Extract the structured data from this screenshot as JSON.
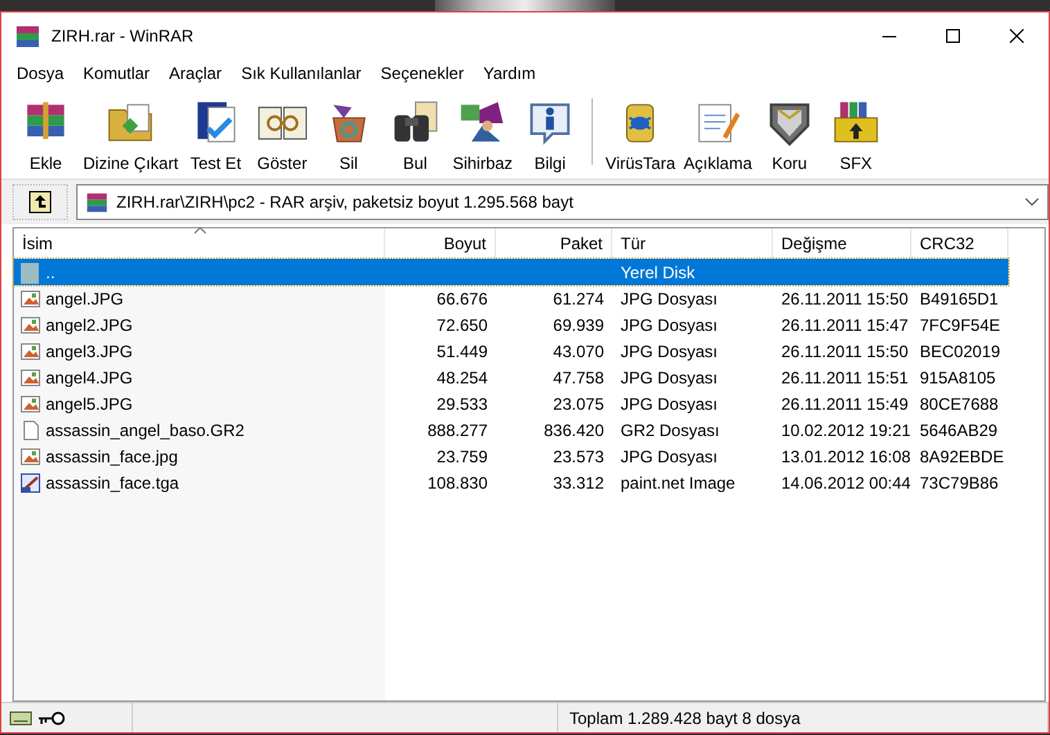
{
  "window": {
    "title": "ZIRH.rar - WinRAR"
  },
  "menu": [
    "Dosya",
    "Komutlar",
    "Araçlar",
    "Sık Kullanılanlar",
    "Seçenekler",
    "Yardım"
  ],
  "toolbar": [
    {
      "label": "Ekle",
      "kind": "books"
    },
    {
      "label": "Dizine Çıkart",
      "kind": "folder"
    },
    {
      "label": "Test Et",
      "kind": "check"
    },
    {
      "label": "Göster",
      "kind": "glasses"
    },
    {
      "label": "Sil",
      "kind": "recycle"
    },
    {
      "label": "Bul",
      "kind": "binoculars"
    },
    {
      "label": "Sihirbaz",
      "kind": "wizard"
    },
    {
      "label": "Bilgi",
      "kind": "info"
    },
    {
      "label": "VirüsTara",
      "kind": "bug"
    },
    {
      "label": "Açıklama",
      "kind": "notepad"
    },
    {
      "label": "Koru",
      "kind": "shield"
    },
    {
      "label": "SFX",
      "kind": "box"
    }
  ],
  "address": {
    "path": "ZIRH.rar\\ZIRH\\pc2 - RAR arşiv, paketsiz boyut 1.295.568 bayt"
  },
  "table": {
    "columns": [
      "İsim",
      "Boyut",
      "Paket",
      "Tür",
      "Değişme",
      "CRC32"
    ],
    "rows": [
      {
        "kind": "up",
        "selected": true,
        "cells": [
          "..",
          "",
          "",
          "Yerel Disk",
          "",
          ""
        ]
      },
      {
        "kind": "image",
        "selected": false,
        "cells": [
          "angel.JPG",
          "66.676",
          "61.274",
          "JPG Dosyası",
          "26.11.2011 15:50",
          "B49165D1"
        ]
      },
      {
        "kind": "image",
        "selected": false,
        "cells": [
          "angel2.JPG",
          "72.650",
          "69.939",
          "JPG Dosyası",
          "26.11.2011 15:47",
          "7FC9F54E"
        ]
      },
      {
        "kind": "image",
        "selected": false,
        "cells": [
          "angel3.JPG",
          "51.449",
          "43.070",
          "JPG Dosyası",
          "26.11.2011 15:50",
          "BEC02019"
        ]
      },
      {
        "kind": "image",
        "selected": false,
        "cells": [
          "angel4.JPG",
          "48.254",
          "47.758",
          "JPG Dosyası",
          "26.11.2011 15:51",
          "915A8105"
        ]
      },
      {
        "kind": "image",
        "selected": false,
        "cells": [
          "angel5.JPG",
          "29.533",
          "23.075",
          "JPG Dosyası",
          "26.11.2011 15:49",
          "80CE7688"
        ]
      },
      {
        "kind": "file",
        "selected": false,
        "cells": [
          "assassin_angel_baso.GR2",
          "888.277",
          "836.420",
          "GR2 Dosyası",
          "10.02.2012 19:21",
          "5646AB29"
        ]
      },
      {
        "kind": "image",
        "selected": false,
        "cells": [
          "assassin_face.jpg",
          "23.759",
          "23.573",
          "JPG Dosyası",
          "13.01.2012 16:08",
          "8A92EBDE"
        ]
      },
      {
        "kind": "paint",
        "selected": false,
        "cells": [
          "assassin_face.tga",
          "108.830",
          "33.312",
          "paint.net Image",
          "14.06.2012 00:44",
          "73C79B86"
        ]
      }
    ]
  },
  "status_bar": {
    "text": "Toplam 1.289.428 bayt 8 dosya"
  }
}
